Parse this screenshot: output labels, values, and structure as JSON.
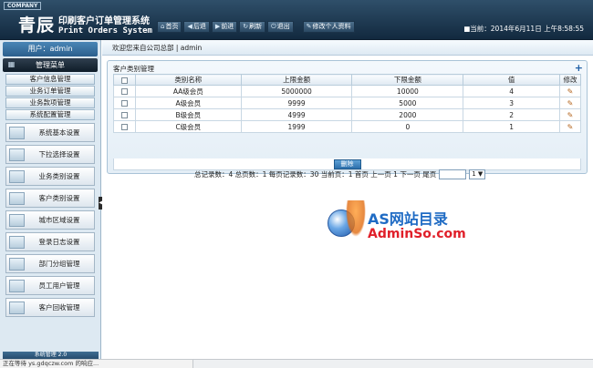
{
  "header": {
    "company_badge": "COMPANY",
    "logo": "青辰",
    "system_name_cn": "印刷客户订单管理系统",
    "system_name_en": "Print Orders System",
    "toolbar": [
      {
        "label": "首页",
        "icon": "home-icon",
        "glyph": "⌂"
      },
      {
        "label": "后退",
        "icon": "back-icon",
        "glyph": "◀"
      },
      {
        "label": "前进",
        "icon": "forward-icon",
        "glyph": "▶"
      },
      {
        "label": "刷新",
        "icon": "refresh-icon",
        "glyph": "↻"
      },
      {
        "label": "退出",
        "icon": "logout-icon",
        "glyph": "⏻"
      }
    ],
    "profile_button": {
      "label": "修改个人资料",
      "icon": "profile-edit-icon",
      "glyph": "✎"
    },
    "current_time_label": "■当前：2014年6月11日 上午8:58:55"
  },
  "sidebar": {
    "user_label": "用户：admin",
    "menu_title": "管理菜单",
    "menu_icon": "grid-icon",
    "sub_items": [
      "客户信息管理",
      "业务订单管理",
      "业务款项管理",
      "系统配置管理"
    ],
    "big_items": [
      "系统基本设置",
      "下拉选择设置",
      "业务类别设置",
      "客户类别设置",
      "城市区域设置",
      "登录日志设置",
      "部门分组管理",
      "员工用户管理",
      "客户回收管理"
    ],
    "footer_text": "系统管理 2.0"
  },
  "main": {
    "welcome": "欢迎您来自公司总部 | admin",
    "panel_title": "客户类别管理",
    "table": {
      "headers": [
        "",
        "类别名称",
        "上限金额",
        "下限金额",
        "值",
        "修改"
      ],
      "rows": [
        {
          "name": "AA级会员",
          "upper": "5000000",
          "lower": "10000",
          "value": "4"
        },
        {
          "name": "A级会员",
          "upper": "9999",
          "lower": "5000",
          "value": "3"
        },
        {
          "name": "B级会员",
          "upper": "4999",
          "lower": "2000",
          "value": "2"
        },
        {
          "name": "C级会员",
          "upper": "1999",
          "lower": "0",
          "value": "1"
        }
      ]
    },
    "delete_button": "删除",
    "pager": {
      "summary": "总记录数：4 总页数：1 每页记录数：30 当前页：1 首页 上一页 1 下一页 尾页",
      "page_select": "1 ▼"
    }
  },
  "watermark": {
    "line1": "AS网站目录",
    "line2": "AdminSo.com"
  },
  "statusbar": {
    "text": "正在等待 ys.gdqczw.com 的响应..."
  },
  "colors": {
    "header_dark": "#12293f",
    "sidebar_bg": "#dde9f2",
    "accent_blue": "#2c6fab"
  }
}
